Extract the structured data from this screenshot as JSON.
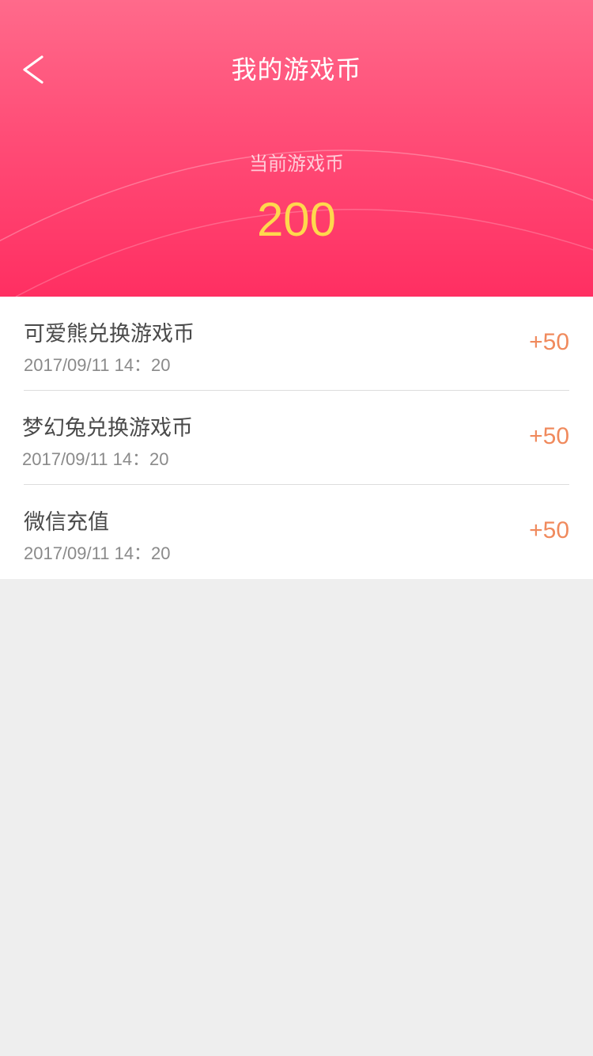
{
  "header": {
    "title": "我的游戏币",
    "back_icon": "chevron-left-icon",
    "balance_label": "当前游戏币",
    "balance_value": "200"
  },
  "records": [
    {
      "name": "可爱熊兑换游戏币",
      "time": "2017/09/11 14：20",
      "amount": "+50"
    },
    {
      "name": "梦幻兔兑换游戏币",
      "time": "2017/09/11 14：20",
      "amount": "+50"
    },
    {
      "name": "微信充值",
      "time": "2017/09/11 14：20",
      "amount": "+50"
    }
  ],
  "colors": {
    "header_top": "#ff6a8b",
    "header_bottom": "#ff2f62",
    "balance": "#ffd84d",
    "amount": "#f08a5d",
    "page_background": "#eeeeee"
  }
}
